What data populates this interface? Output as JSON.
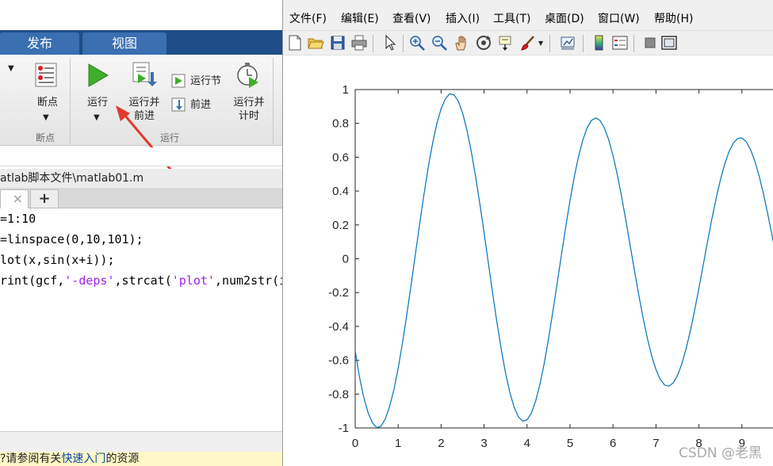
{
  "editor": {
    "ribbon_tabs": [
      "发布",
      "视图"
    ],
    "ribbon": {
      "breakpoints_label": "断点",
      "breakpoints_group": "断点",
      "run_label": "运行",
      "run_advance_label": [
        "运行并",
        "前进"
      ],
      "run_section_label": "运行节",
      "advance_label": "前进",
      "run_time_label": [
        "运行并",
        "计时"
      ],
      "run_group": "运行"
    },
    "file_path": "atlab脚本文件\\matlab01.m",
    "add_tab_label": "+",
    "close_tab_glyph": "×",
    "code_lines": [
      "=1:10",
      "=linspace(0,10,101);",
      "lot(x,sin(x+i));",
      "rint(gcf,'-deps',strcat('plot',num2str(i"
    ],
    "status_text_before": "?请参阅有关",
    "status_link": "快速入门",
    "status_text_after": "的资源"
  },
  "figure": {
    "menu": [
      "文件(F)",
      "编辑(E)",
      "查看(V)",
      "插入(I)",
      "工具(T)",
      "桌面(D)",
      "窗口(W)",
      "帮助(H)"
    ],
    "toolbar_icons": [
      "new-figure-icon",
      "open-file-icon",
      "save-icon",
      "print-icon",
      "pointer-icon",
      "zoom-in-icon",
      "zoom-out-icon",
      "pan-hand-icon",
      "rotate-3d-icon",
      "data-cursor-icon",
      "brush-icon",
      "link-plot-icon",
      "colorbar-icon",
      "legend-icon",
      "hide-tools-icon",
      "show-tools-icon"
    ],
    "watermark": "CSDN @老黑"
  },
  "chart_data": {
    "type": "line",
    "title": "",
    "xlabel": "",
    "ylabel": "",
    "xlim": [
      0,
      10
    ],
    "ylim": [
      -1,
      1
    ],
    "xticks": [
      0,
      1,
      2,
      3,
      4,
      5,
      6,
      7,
      8,
      9
    ],
    "yticks": [
      -1,
      -0.8,
      -0.6,
      -0.4,
      -0.2,
      0,
      0.2,
      0.4,
      0.6,
      0.8,
      1
    ],
    "ytick_labels": [
      "-1",
      "-0.8",
      "-0.6",
      "-0.4",
      "-0.2",
      "0",
      "0.2",
      "0.4",
      "0.6",
      "0.8",
      "1"
    ],
    "grid": false,
    "series": [
      {
        "color": "#0072bd",
        "x": [
          0,
          0.1,
          0.2,
          0.3,
          0.4,
          0.5,
          0.6,
          0.7,
          0.8,
          0.9,
          1.0,
          1.1,
          1.2,
          1.3,
          1.4,
          1.5,
          1.6,
          1.7,
          1.8,
          1.9,
          2.0,
          2.1,
          2.2,
          2.3,
          2.4,
          2.5,
          2.6,
          2.7,
          2.8,
          2.9,
          3.0,
          3.1,
          3.2,
          3.3,
          3.4,
          3.5,
          3.6,
          3.7,
          3.8,
          3.9,
          4.0,
          4.1,
          4.2,
          4.3,
          4.4,
          4.5,
          4.6,
          4.7,
          4.8,
          4.9,
          5.0,
          5.1,
          5.2,
          5.3,
          5.4,
          5.5,
          5.6,
          5.7,
          5.8,
          5.9,
          6.0,
          6.1,
          6.2,
          6.3,
          6.4,
          6.5,
          6.6,
          6.7,
          6.8,
          6.9,
          7.0,
          7.1,
          7.2,
          7.3,
          7.4,
          7.5,
          7.6,
          7.7,
          7.8,
          7.9,
          8.0,
          8.1,
          8.2,
          8.3,
          8.4,
          8.5,
          8.6,
          8.7,
          8.8,
          8.9,
          9.0,
          9.1,
          9.2,
          9.3,
          9.4,
          9.5,
          9.6,
          9.7,
          9.8,
          9.9,
          10.0
        ],
        "y": [
          -0.544,
          -0.7,
          -0.819,
          -0.91,
          -0.97,
          -0.998,
          -0.99,
          -0.947,
          -0.874,
          -0.774,
          -0.648,
          -0.499,
          -0.333,
          -0.156,
          0.025,
          0.206,
          0.379,
          0.54,
          0.681,
          0.798,
          0.887,
          0.946,
          0.975,
          0.969,
          0.931,
          0.861,
          0.761,
          0.636,
          0.489,
          0.326,
          0.154,
          -0.026,
          -0.206,
          -0.378,
          -0.537,
          -0.676,
          -0.791,
          -0.878,
          -0.935,
          -0.96,
          -0.952,
          -0.912,
          -0.841,
          -0.741,
          -0.617,
          -0.472,
          -0.313,
          -0.146,
          0.023,
          0.189,
          0.345,
          0.486,
          0.607,
          0.704,
          0.775,
          0.818,
          0.832,
          0.817,
          0.773,
          0.703,
          0.61,
          0.497,
          0.367,
          0.226,
          0.078,
          -0.071,
          -0.215,
          -0.35,
          -0.47,
          -0.573,
          -0.655,
          -0.713,
          -0.746,
          -0.753,
          -0.734,
          -0.69,
          -0.622,
          -0.533,
          -0.426,
          -0.304,
          -0.173,
          -0.036,
          0.101,
          0.234,
          0.357,
          0.467,
          0.56,
          0.633,
          0.684,
          0.711,
          0.714,
          0.692,
          0.646,
          0.578,
          0.49,
          0.385,
          0.267,
          0.139,
          0.006,
          -0.127,
          -0.255
        ]
      }
    ]
  }
}
